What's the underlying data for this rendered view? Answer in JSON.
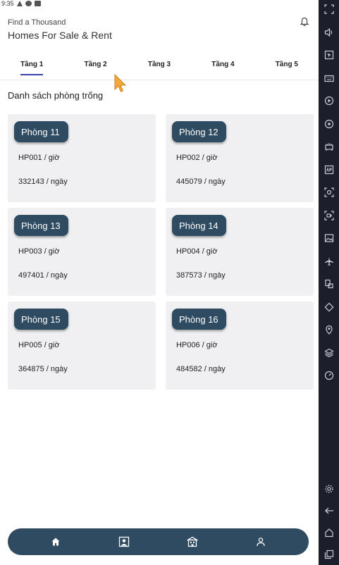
{
  "status_bar": {
    "time": "9:35"
  },
  "header": {
    "subtitle": "Find a Thousand",
    "title": "Homes For Sale & Rent"
  },
  "tabs": [
    {
      "label": "Tầng 1",
      "active": true
    },
    {
      "label": "Tầng 2",
      "active": false
    },
    {
      "label": "Tầng 3",
      "active": false
    },
    {
      "label": "Tầng 4",
      "active": false
    },
    {
      "label": "Tầng 5",
      "active": false
    }
  ],
  "section_title": "Danh sách phòng trống",
  "rooms": [
    {
      "name": "Phòng 11",
      "code": "HP001 / giờ",
      "price": "332143 / ngày"
    },
    {
      "name": "Phòng 12",
      "code": "HP002 / giờ",
      "price": "445079 / ngày"
    },
    {
      "name": "Phòng 13",
      "code": "HP003 / giờ",
      "price": "497401 / ngày"
    },
    {
      "name": "Phòng 14",
      "code": "HP004 / giờ",
      "price": "387573 / ngày"
    },
    {
      "name": "Phòng 15",
      "code": "HP005 / giờ",
      "price": "364875 / ngày"
    },
    {
      "name": "Phòng 16",
      "code": "HP006 / giờ",
      "price": "484582 / ngày"
    }
  ],
  "bottom_nav": [
    {
      "icon": "home-icon"
    },
    {
      "icon": "contact-card-icon"
    },
    {
      "icon": "building-icon"
    },
    {
      "icon": "user-icon"
    }
  ],
  "emulator_toolbar": [
    "fullscreen-icon",
    "volume-icon",
    "cursor-icon",
    "keyboard-icon",
    "play-icon",
    "target-icon",
    "sync-icon",
    "apk-icon",
    "camera-icon",
    "record-icon",
    "image-icon",
    "airplane-icon",
    "multi-window-icon",
    "rotate-icon",
    "location-icon",
    "layers-icon",
    "speed-icon",
    "settings-icon",
    "back-icon",
    "home-icon",
    "recent-apps-icon"
  ],
  "colors": {
    "primary": "#2f4b62",
    "tab_indicator": "#3a3fb0",
    "card_bg": "#f0f0f2",
    "toolbar_bg": "#1c1f2b"
  }
}
